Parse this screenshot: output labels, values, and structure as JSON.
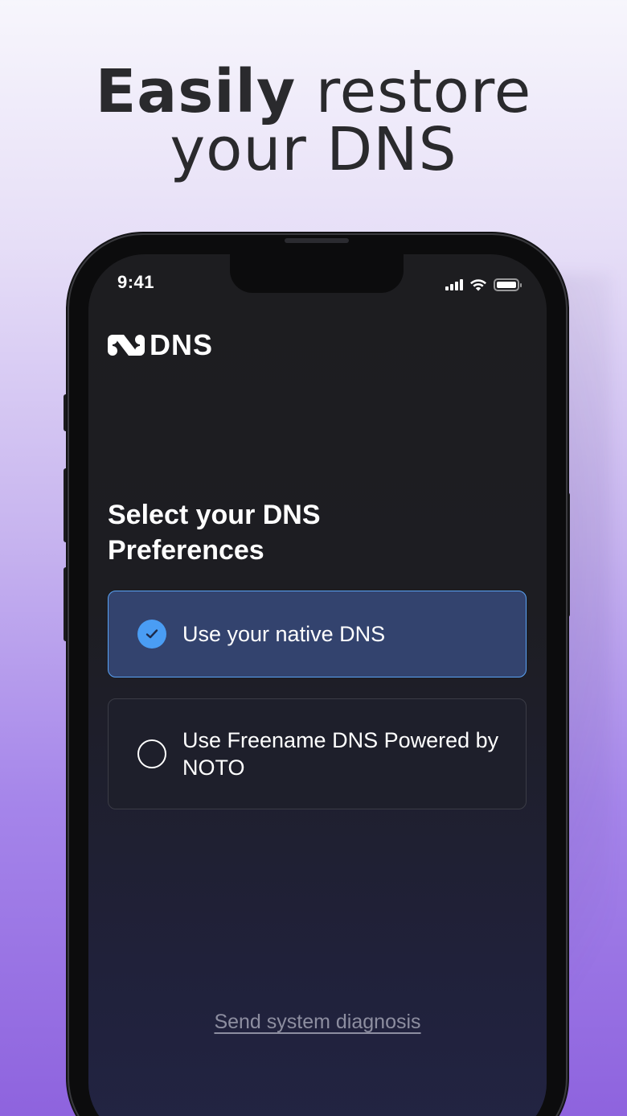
{
  "headline": {
    "bold": "Easily",
    "rest": "restore",
    "line2": "your DNS"
  },
  "status_bar": {
    "time": "9:41",
    "icons": [
      "cellular-signal-icon",
      "wifi-icon",
      "battery-icon"
    ]
  },
  "app": {
    "brand": "DNS",
    "logo_icon": "noto-logo-icon"
  },
  "preferences": {
    "title": "Select your DNS Preferences",
    "options": [
      {
        "label": "Use your native DNS",
        "selected": true
      },
      {
        "label": "Use Freename DNS Powered by NOTO",
        "selected": false
      }
    ]
  },
  "footer": {
    "diagnosis_link": "Send system diagnosis"
  },
  "colors": {
    "accent_blue": "#4a9df4",
    "selected_bg": "#33436e",
    "selected_border": "#5aa3f5",
    "screen_bg": "#1d1d20",
    "page_bg_bottom": "#8e63de"
  }
}
